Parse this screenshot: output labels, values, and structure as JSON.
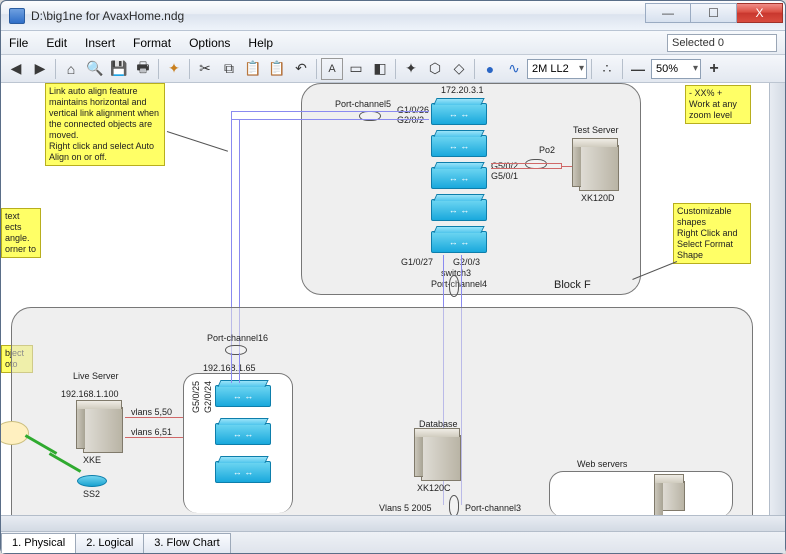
{
  "window": {
    "title": "D:\\big1ne for AvaxHome.ndg",
    "minimize": "—",
    "maximize": "☐",
    "close": "X"
  },
  "menu": {
    "file": "File",
    "edit": "Edit",
    "insert": "Insert",
    "format": "Format",
    "options": "Options",
    "help": "Help",
    "selected": "Selected 0"
  },
  "toolbar": {
    "back": "◀",
    "forward": "▶",
    "home": "⌂",
    "find": "🔍",
    "save": "💾",
    "print": "🖶",
    "cut": "✂",
    "copy": "⧉",
    "paste": "📋",
    "paste2": "📋",
    "undo": "↶",
    "textfmt": "A",
    "rect": "▭",
    "colorshape": "◧",
    "snap1": "✦",
    "snap2": "⬡",
    "snap3": "◇",
    "globe": "●",
    "path": "∿",
    "layer_combo": "2M LL2",
    "dots": "∴",
    "minus": "—",
    "zoom_combo": "50%",
    "plus": "+"
  },
  "notes": {
    "autoalign": "Link auto align feature maintains horizontal and vertical link alignment when the connected objects are moved.\nRight click and select Auto Align on or off.",
    "textobj": "text\nects\nangle.\norner to",
    "objphoto": "bject\noto",
    "zoom": "- XX% +\nWork at any zoom level",
    "shapes": "Customizable shapes\nRight Click and Select Format Shape"
  },
  "diagram": {
    "block_f": "Block F",
    "block_f_ip": "172.20.3.1",
    "pc5": "Port-channel5",
    "pc4": "Port-channel4",
    "pc16": "Port-channel16",
    "pc3": "Port-channel3",
    "sw3": "switch3",
    "g1026": "G1/0/26",
    "g202": "G2/0/2",
    "g502": "G5/0/2",
    "g501": "G5/0/1",
    "g1027": "G1/0/27",
    "g203": "G2/0/3",
    "g5025": "G5/0/25",
    "g2024": "G2/0/24",
    "po2": "Po2",
    "ts": "Test Server",
    "xk120d": "XK120D",
    "ip65": "192.168.1.65",
    "ls": "Live Server",
    "ip100": "192.168.1.100",
    "v550": "vlans 5,50",
    "v651": "vlans 6,51",
    "xke": "XKE",
    "ss2": "SS2",
    "db": "Database",
    "xk120c": "XK120C",
    "ws": "Web servers",
    "vlanx": "Vlans 5 2005"
  },
  "tabs": {
    "t1": "1. Physical",
    "t2": "2. Logical",
    "t3": "3. Flow Chart"
  }
}
